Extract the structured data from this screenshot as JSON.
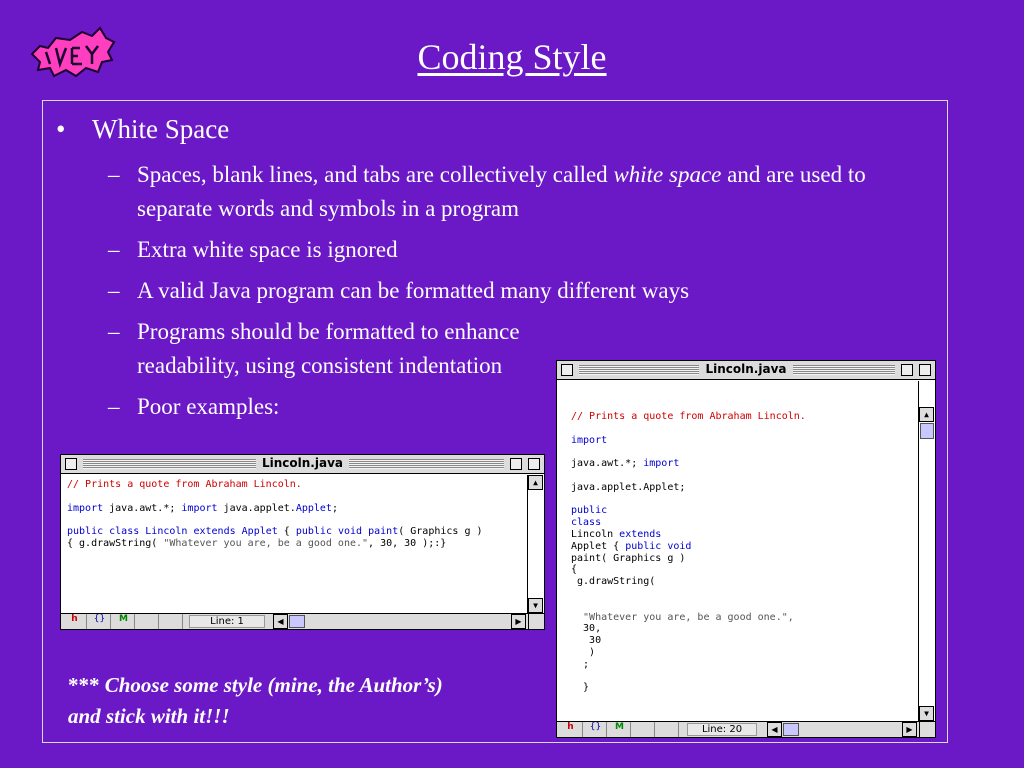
{
  "slide": {
    "title": "Coding Style",
    "bullet": "White Space",
    "sub_items": [
      {
        "pre": "Spaces, blank lines, and tabs are collectively called ",
        "em": "white space",
        "post": "  and are used to separate words and symbols in a program"
      },
      {
        "pre": "Extra white space is ignored",
        "em": "",
        "post": ""
      },
      {
        "pre": "A valid Java program can be formatted many different ways",
        "em": "",
        "post": ""
      },
      {
        "pre": "Programs should be formatted to enhance readability, using consistent indentation",
        "em": "",
        "post": ""
      },
      {
        "pre": "Poor examples:",
        "em": "",
        "post": ""
      }
    ],
    "note_prefix": "*** ",
    "note_text": "Choose some style (mine, the Author’s) and stick with it!!!"
  },
  "colors": {
    "background": "#6b18c6",
    "logo": "#ff3fbf",
    "comment": "#d00000",
    "keyword": "#0000d0"
  },
  "bullet_glyph": "•",
  "dash_glyph": "–",
  "window_small": {
    "title": "Lincoln.java",
    "line_label": "Line: 1",
    "code": [
      [
        [
          "c",
          "// Prints a quote from Abraham Lincoln."
        ]
      ],
      [
        [
          "p",
          ""
        ]
      ],
      [
        [
          "k",
          "import"
        ],
        [
          "p",
          " java.awt.*; "
        ],
        [
          "k",
          "import"
        ],
        [
          "p",
          " java.applet."
        ],
        [
          "k",
          "Applet"
        ],
        [
          "p",
          ";"
        ]
      ],
      [
        [
          "p",
          ""
        ]
      ],
      [
        [
          "k",
          "public class"
        ],
        [
          "p",
          " "
        ],
        [
          "k",
          "Lincoln"
        ],
        [
          "p",
          " "
        ],
        [
          "k",
          "extends"
        ],
        [
          "p",
          " "
        ],
        [
          "k",
          "Applet"
        ],
        [
          "p",
          " { "
        ],
        [
          "k",
          "public void"
        ],
        [
          "p",
          " "
        ],
        [
          "k",
          "paint"
        ],
        [
          "p",
          "( Graphics g )"
        ]
      ],
      [
        [
          "p",
          "{ g.drawString( "
        ],
        [
          "s",
          "\"Whatever you are, be a good one.\""
        ],
        [
          "p",
          ", 30, 30 );:}"
        ]
      ]
    ]
  },
  "window_large": {
    "title": "Lincoln.java",
    "line_label": "Line: 20",
    "code": [
      [
        [
          "c",
          "// Prints a quote from Abraham Lincoln."
        ]
      ],
      [
        [
          "p",
          ""
        ]
      ],
      [
        [
          "k",
          "import"
        ]
      ],
      [
        [
          "p",
          ""
        ]
      ],
      [
        [
          "p",
          "java.awt.*; "
        ],
        [
          "k",
          "import"
        ]
      ],
      [
        [
          "p",
          ""
        ]
      ],
      [
        [
          "p",
          "java.applet.Applet;"
        ]
      ],
      [
        [
          "p",
          ""
        ]
      ],
      [
        [
          "k",
          "public"
        ]
      ],
      [
        [
          "k",
          "class"
        ]
      ],
      [
        [
          "p",
          "Lincoln "
        ],
        [
          "k",
          "extends"
        ]
      ],
      [
        [
          "p",
          "Applet { "
        ],
        [
          "k",
          "public void"
        ]
      ],
      [
        [
          "p",
          "paint( Graphics g )"
        ]
      ],
      [
        [
          "p",
          "{"
        ]
      ],
      [
        [
          "p",
          " g.drawString("
        ]
      ],
      [
        [
          "p",
          ""
        ]
      ],
      [
        [
          "p",
          ""
        ]
      ],
      [
        [
          "s",
          "  \"Whatever you are, be a good one.\","
        ]
      ],
      [
        [
          "p",
          "  30,"
        ]
      ],
      [
        [
          "p",
          "   30"
        ]
      ],
      [
        [
          "p",
          "   )"
        ]
      ],
      [
        [
          "p",
          "  ;"
        ]
      ],
      [
        [
          "p",
          ""
        ]
      ],
      [
        [
          "p",
          "  }"
        ]
      ]
    ]
  }
}
